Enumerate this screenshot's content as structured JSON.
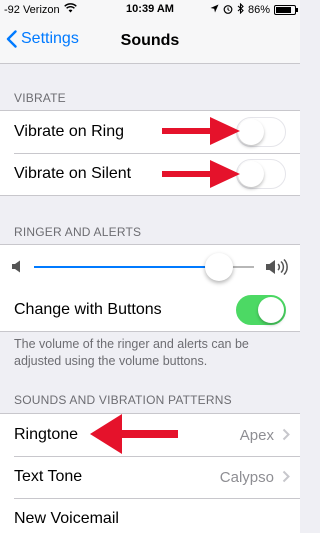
{
  "status_bar": {
    "carrier": "-92 Verizon",
    "time": "10:39 AM",
    "battery": "86%",
    "battery_level": 0.86,
    "icons": [
      "wifi-icon",
      "location-icon",
      "alarm-icon",
      "bluetooth-icon",
      "battery-icon"
    ]
  },
  "nav": {
    "back_label": "Settings",
    "title": "Sounds"
  },
  "vibrate": {
    "header": "VIBRATE",
    "items": [
      {
        "label": "Vibrate on Ring",
        "on": false
      },
      {
        "label": "Vibrate on Silent",
        "on": false
      }
    ]
  },
  "ringer": {
    "header": "RINGER AND ALERTS",
    "volume_level": 0.84,
    "change_with_buttons": {
      "label": "Change with Buttons",
      "on": true
    },
    "note": "The volume of the ringer and alerts can be adjusted using the volume buttons."
  },
  "patterns": {
    "header": "SOUNDS AND VIBRATION PATTERNS",
    "items": [
      {
        "label": "Ringtone",
        "value": "Apex"
      },
      {
        "label": "Text Tone",
        "value": "Calypso"
      },
      {
        "label": "New Voicemail",
        "value": ""
      }
    ]
  },
  "colors": {
    "accent": "#007aff",
    "toggle_on": "#4cd964",
    "arrow": "#e5122b",
    "group_bg": "#efeff4"
  }
}
